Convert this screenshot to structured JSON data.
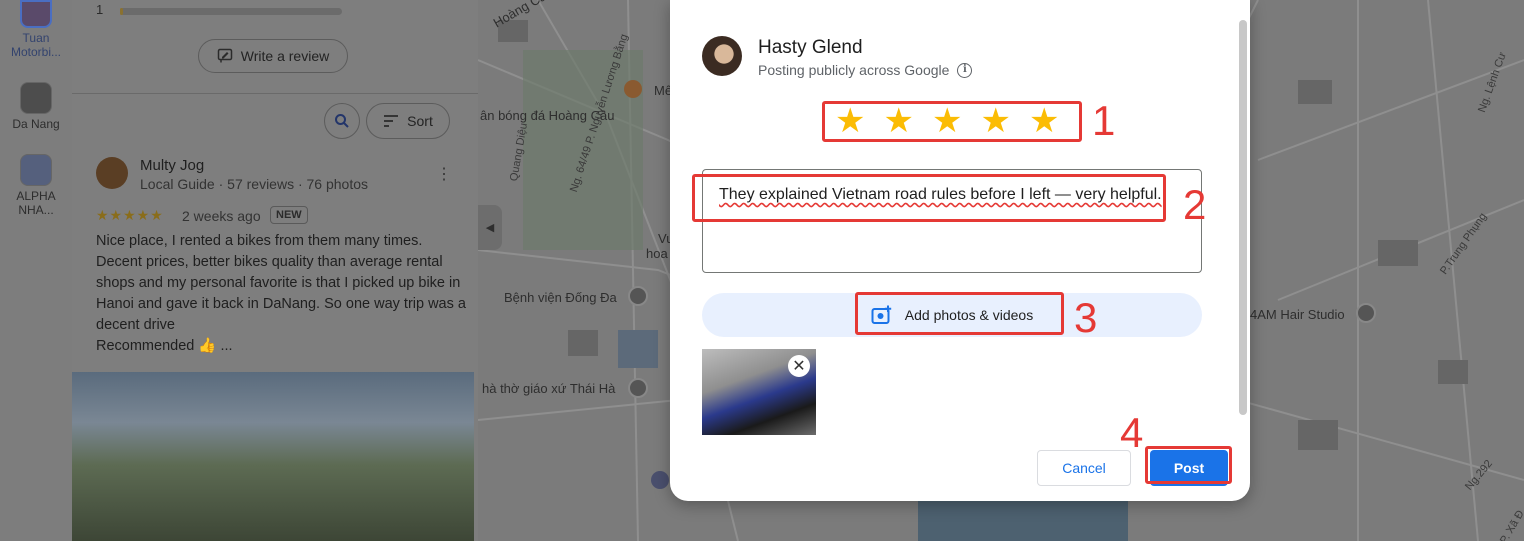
{
  "rail": {
    "items": [
      {
        "label_line1": "Tuan",
        "label_line2": "Motorbi..."
      },
      {
        "label_line1": "Da Nang",
        "label_line2": ""
      },
      {
        "label_line1": "ALPHA",
        "label_line2": "NHA..."
      }
    ]
  },
  "panel": {
    "rating_bar": {
      "star": "1",
      "fill_fraction": 0.01
    },
    "write_review_label": "Write a review",
    "sort_label": "Sort",
    "review": {
      "name": "Multy Jog",
      "meta": "Local Guide · 57 reviews · 76 photos",
      "stars": "★★★★★",
      "time": "2 weeks ago",
      "badge": "NEW",
      "text": "Nice place, I rented a bikes from them many times. Decent prices, better bikes quality than average rental shops and my personal favorite is that I picked up bike in Hanoi and gave it back in DaNang. So one way trip was a decent drive",
      "text2": "Recommended 👍 ..."
    }
  },
  "map": {
    "labels": [
      "Hoàng Cầu",
      "Mê",
      "ân bóng đá Hoàng Cầu",
      "Bệnh viện Đống Đa",
      "Vu",
      "hoa",
      "hà thờ giáo xứ Thái Hà",
      "4AM Hair Studio"
    ],
    "roads": [
      "Ng. 64/49 P. Nguyễn Lương Bằng",
      "Quang Diệu",
      "P.Trung Phụng",
      "Ng.292",
      "Ng. Lệnh Cư",
      "P. Xã Đ",
      "Ng",
      "Ng"
    ]
  },
  "dialog": {
    "user_name": "Hasty Glend",
    "posting_note": "Posting publicly across Google",
    "rating": 5,
    "review_text": "They explained Vietnam road rules before I left — very helpful.",
    "add_media_label": "Add photos & videos",
    "cancel_label": "Cancel",
    "post_label": "Post"
  },
  "annotations": [
    "1",
    "2",
    "3",
    "4"
  ],
  "colors": {
    "accent": "#1a73e8",
    "star": "#fbbc04",
    "annotation": "#e53935"
  }
}
